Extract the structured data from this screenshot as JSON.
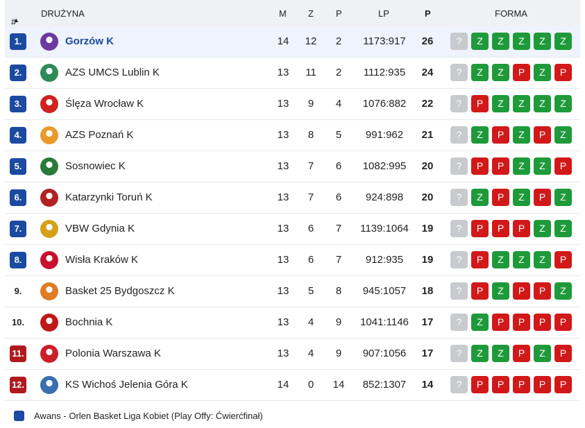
{
  "header": {
    "rank": "#",
    "sort_arrow": "▲",
    "team": "DRUŻYNA",
    "m": "M",
    "z": "Z",
    "p": "P",
    "lp": "LP",
    "pts": "P",
    "form": "FORMA"
  },
  "colors": {
    "promotion": "#1b4aa0",
    "relegation": "#b01a1f",
    "win": "#1f9a3a",
    "loss": "#d21919",
    "next": "#c8cacd"
  },
  "rows": [
    {
      "rank": "1.",
      "zone": "blue",
      "team": "Gorzów K",
      "m": "14",
      "w": "12",
      "l": "2",
      "lp": "1173:917",
      "pts": "26",
      "logo": "#6a3aa0",
      "highlight": true,
      "form": [
        "?",
        "Z",
        "Z",
        "Z",
        "Z",
        "Z"
      ]
    },
    {
      "rank": "2.",
      "zone": "blue",
      "team": "AZS UMCS Lublin K",
      "m": "13",
      "w": "11",
      "l": "2",
      "lp": "1112:935",
      "pts": "24",
      "logo": "#2e8b57",
      "form": [
        "?",
        "Z",
        "Z",
        "P",
        "Z",
        "P"
      ]
    },
    {
      "rank": "3.",
      "zone": "blue",
      "team": "Ślęza Wrocław K",
      "m": "13",
      "w": "9",
      "l": "4",
      "lp": "1076:882",
      "pts": "22",
      "logo": "#d22020",
      "form": [
        "?",
        "P",
        "Z",
        "Z",
        "Z",
        "Z"
      ]
    },
    {
      "rank": "4.",
      "zone": "blue",
      "team": "AZS Poznań K",
      "m": "13",
      "w": "8",
      "l": "5",
      "lp": "991:962",
      "pts": "21",
      "logo": "#e89a2c",
      "form": [
        "?",
        "Z",
        "P",
        "Z",
        "P",
        "Z"
      ]
    },
    {
      "rank": "5.",
      "zone": "blue",
      "team": "Sosnowiec K",
      "m": "13",
      "w": "7",
      "l": "6",
      "lp": "1082:995",
      "pts": "20",
      "logo": "#2a7a3a",
      "form": [
        "?",
        "P",
        "P",
        "Z",
        "Z",
        "P"
      ]
    },
    {
      "rank": "6.",
      "zone": "blue",
      "team": "Katarzynki Toruń K",
      "m": "13",
      "w": "7",
      "l": "6",
      "lp": "924:898",
      "pts": "20",
      "logo": "#b22222",
      "form": [
        "?",
        "Z",
        "P",
        "Z",
        "P",
        "Z"
      ]
    },
    {
      "rank": "7.",
      "zone": "blue",
      "team": "VBW Gdynia K",
      "m": "13",
      "w": "6",
      "l": "7",
      "lp": "1139:1064",
      "pts": "19",
      "logo": "#d4a017",
      "form": [
        "?",
        "P",
        "P",
        "P",
        "Z",
        "Z"
      ]
    },
    {
      "rank": "8.",
      "zone": "blue",
      "team": "Wisła Kraków K",
      "m": "13",
      "w": "6",
      "l": "7",
      "lp": "912:935",
      "pts": "19",
      "logo": "#c8102e",
      "form": [
        "?",
        "P",
        "Z",
        "Z",
        "Z",
        "P"
      ]
    },
    {
      "rank": "9.",
      "zone": "none",
      "team": "Basket 25 Bydgoszcz K",
      "m": "13",
      "w": "5",
      "l": "8",
      "lp": "945:1057",
      "pts": "18",
      "logo": "#e07b24",
      "form": [
        "?",
        "P",
        "Z",
        "P",
        "P",
        "Z"
      ]
    },
    {
      "rank": "10.",
      "zone": "none",
      "team": "Bochnia K",
      "m": "13",
      "w": "4",
      "l": "9",
      "lp": "1041:1146",
      "pts": "17",
      "logo": "#c01818",
      "form": [
        "?",
        "Z",
        "P",
        "P",
        "P",
        "P"
      ]
    },
    {
      "rank": "11.",
      "zone": "red",
      "team": "Polonia Warszawa K",
      "m": "13",
      "w": "4",
      "l": "9",
      "lp": "907:1056",
      "pts": "17",
      "logo": "#cc1f2a",
      "form": [
        "?",
        "Z",
        "Z",
        "P",
        "Z",
        "P"
      ]
    },
    {
      "rank": "12.",
      "zone": "red",
      "team": "KS Wichoś Jelenia Góra K",
      "m": "14",
      "w": "0",
      "l": "14",
      "lp": "852:1307",
      "pts": "14",
      "logo": "#3a6fb0",
      "form": [
        "?",
        "P",
        "P",
        "P",
        "P",
        "P"
      ]
    }
  ],
  "legend": {
    "label": "Awans - Orlen Basket Liga Kobiet (Play Offy: Ćwierćfinał)"
  }
}
